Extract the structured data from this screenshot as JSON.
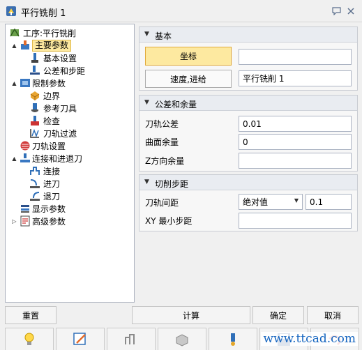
{
  "window": {
    "title": "平行铣削 1"
  },
  "tree": {
    "items": [
      {
        "label": "工序:平行铣削",
        "level": 0,
        "expander": "",
        "icon": "operation-icon"
      },
      {
        "label": "主要参数",
        "level": 1,
        "expander": "▲",
        "icon": "main-params-icon",
        "selected": true
      },
      {
        "label": "基本设置",
        "level": 2,
        "expander": "",
        "icon": "basic-settings-icon"
      },
      {
        "label": "公差和步距",
        "level": 2,
        "expander": "",
        "icon": "tolerance-icon"
      },
      {
        "label": "限制参数",
        "level": 1,
        "expander": "▲",
        "icon": "limit-params-icon"
      },
      {
        "label": "边界",
        "level": 2,
        "expander": "",
        "icon": "boundary-icon"
      },
      {
        "label": "参考刀具",
        "level": 2,
        "expander": "",
        "icon": "reference-tool-icon"
      },
      {
        "label": "检查",
        "level": 2,
        "expander": "",
        "icon": "check-icon"
      },
      {
        "label": "刀轨过滤",
        "level": 2,
        "expander": "",
        "icon": "toolpath-filter-icon"
      },
      {
        "label": "刀轨设置",
        "level": 1,
        "expander": "",
        "icon": "toolpath-settings-icon"
      },
      {
        "label": "连接和进退刀",
        "level": 1,
        "expander": "▲",
        "icon": "link-leadin-icon"
      },
      {
        "label": "连接",
        "level": 2,
        "expander": "",
        "icon": "link-icon"
      },
      {
        "label": "进刀",
        "level": 2,
        "expander": "",
        "icon": "lead-in-icon"
      },
      {
        "label": "退刀",
        "level": 2,
        "expander": "",
        "icon": "lead-out-icon"
      },
      {
        "label": "显示参数",
        "level": 1,
        "expander": "",
        "icon": "display-params-icon"
      },
      {
        "label": "高级参数",
        "level": 1,
        "expander": "▷",
        "icon": "advanced-params-icon"
      }
    ]
  },
  "groups": {
    "basic": {
      "title": "基本",
      "coord_button": "坐标",
      "coord_value": "",
      "feed_button": "速度,进给",
      "feed_value": "平行铣削 1"
    },
    "tolerance": {
      "title": "公差和余量",
      "path_tol_label": "刀轨公差",
      "path_tol_value": "0.01",
      "surface_stock_label": "曲面余量",
      "surface_stock_value": "0",
      "z_stock_label": "Z方向余量",
      "z_stock_value": ""
    },
    "stepover": {
      "title": "切削步距",
      "path_spacing_label": "刀轨间距",
      "mode_selected": "绝对值",
      "spacing_value": "0.1",
      "xy_min_label": "XY 最小步距",
      "xy_min_value": ""
    }
  },
  "buttons": {
    "reset": "重置",
    "compute": "计算",
    "ok": "确定",
    "cancel": "取消"
  },
  "toolbar": [
    "lightbulb-icon",
    "edit-icon",
    "toolpath-icon",
    "simulate-icon",
    "tool-path-view-icon",
    "save-icon",
    "undo-icon"
  ],
  "watermark": "www.ttcad.com",
  "colors": {
    "selection": "#fde9a0",
    "selection_border": "#e0b94a",
    "accent": "#1565c0"
  }
}
